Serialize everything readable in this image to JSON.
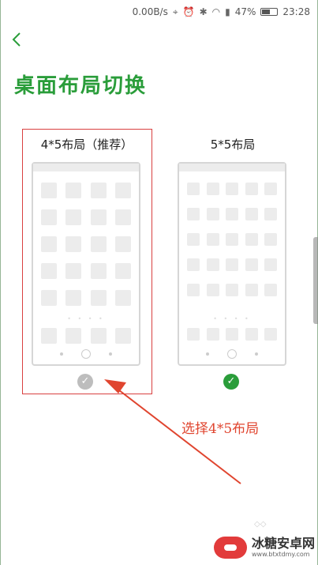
{
  "statusbar": {
    "speed": "0.00B/s",
    "battery": "47%",
    "time": "23:28",
    "battery_level": 0.47
  },
  "header": {
    "back_icon": "chevron-left-icon",
    "title": "桌面布局切换"
  },
  "options": [
    {
      "label": "4*5布局（推荐）",
      "columns": 4,
      "rows_main": 5,
      "dock": 4,
      "selected": false
    },
    {
      "label": "5*5布局",
      "columns": 5,
      "rows_main": 5,
      "dock": 5,
      "selected": true
    }
  ],
  "annotation": {
    "text": "选择4*5布局",
    "color": "#e0452f"
  },
  "watermark": {
    "main": "冰糖安卓网",
    "sub": "www.btxtdmy.com"
  },
  "colors": {
    "accent": "#2a9d3a",
    "unselected_check": "#bdbdbd",
    "highlight": "#d94040"
  }
}
